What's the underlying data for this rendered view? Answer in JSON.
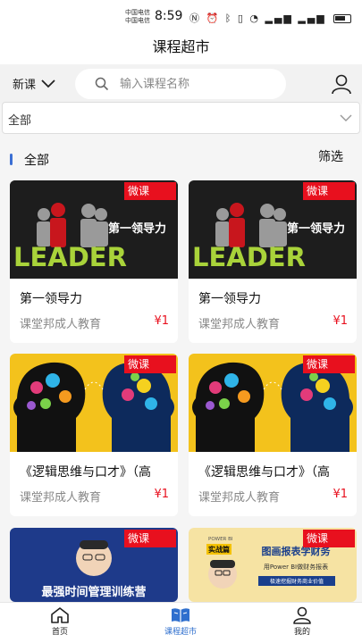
{
  "status_bar": {
    "carrier_line1": "中国电信",
    "carrier_line2": "中国电信",
    "time": "8:59"
  },
  "header": {
    "title": "课程超市"
  },
  "search": {
    "category": "新课",
    "placeholder": "输入课程名称"
  },
  "filter": {
    "selected": "全部"
  },
  "section": {
    "label": "全部",
    "filter_label": "筛选"
  },
  "courses": [
    {
      "title": "第一领导力",
      "org": "课堂邦成人教育",
      "price": "¥1",
      "tag": "微课",
      "thumb_text": "第一领导力",
      "thumb_word": "LEADER"
    },
    {
      "title": "第一领导力",
      "org": "课堂邦成人教育",
      "price": "¥1",
      "tag": "微课",
      "thumb_text": "第一领导力",
      "thumb_word": "LEADER"
    },
    {
      "title": "《逻辑思维与口才》（高",
      "org": "课堂邦成人教育",
      "price": "¥1",
      "tag": "微课"
    },
    {
      "title": "《逻辑思维与口才》（高",
      "org": "课堂邦成人教育",
      "price": "¥1",
      "tag": "微课"
    },
    {
      "title": "",
      "org": "",
      "price": "",
      "tag": "微课",
      "thumb_text": "最强时间管理训练营"
    },
    {
      "title": "",
      "org": "",
      "price": "",
      "tag": "微课",
      "thumb_badge": "实战篇",
      "thumb_brand": "POWER BI",
      "thumb_text": "图画报表学财务",
      "thumb_sub": "用Power BI做财务报表",
      "thumb_foot": "极速挖掘财务商业价值"
    }
  ],
  "tabbar": {
    "items": [
      {
        "label": "首页"
      },
      {
        "label": "课程超市"
      },
      {
        "label": "我的"
      }
    ]
  },
  "colors": {
    "accent": "#2f6fce",
    "tag_red": "#e8101e",
    "price_red": "#e8101e"
  }
}
